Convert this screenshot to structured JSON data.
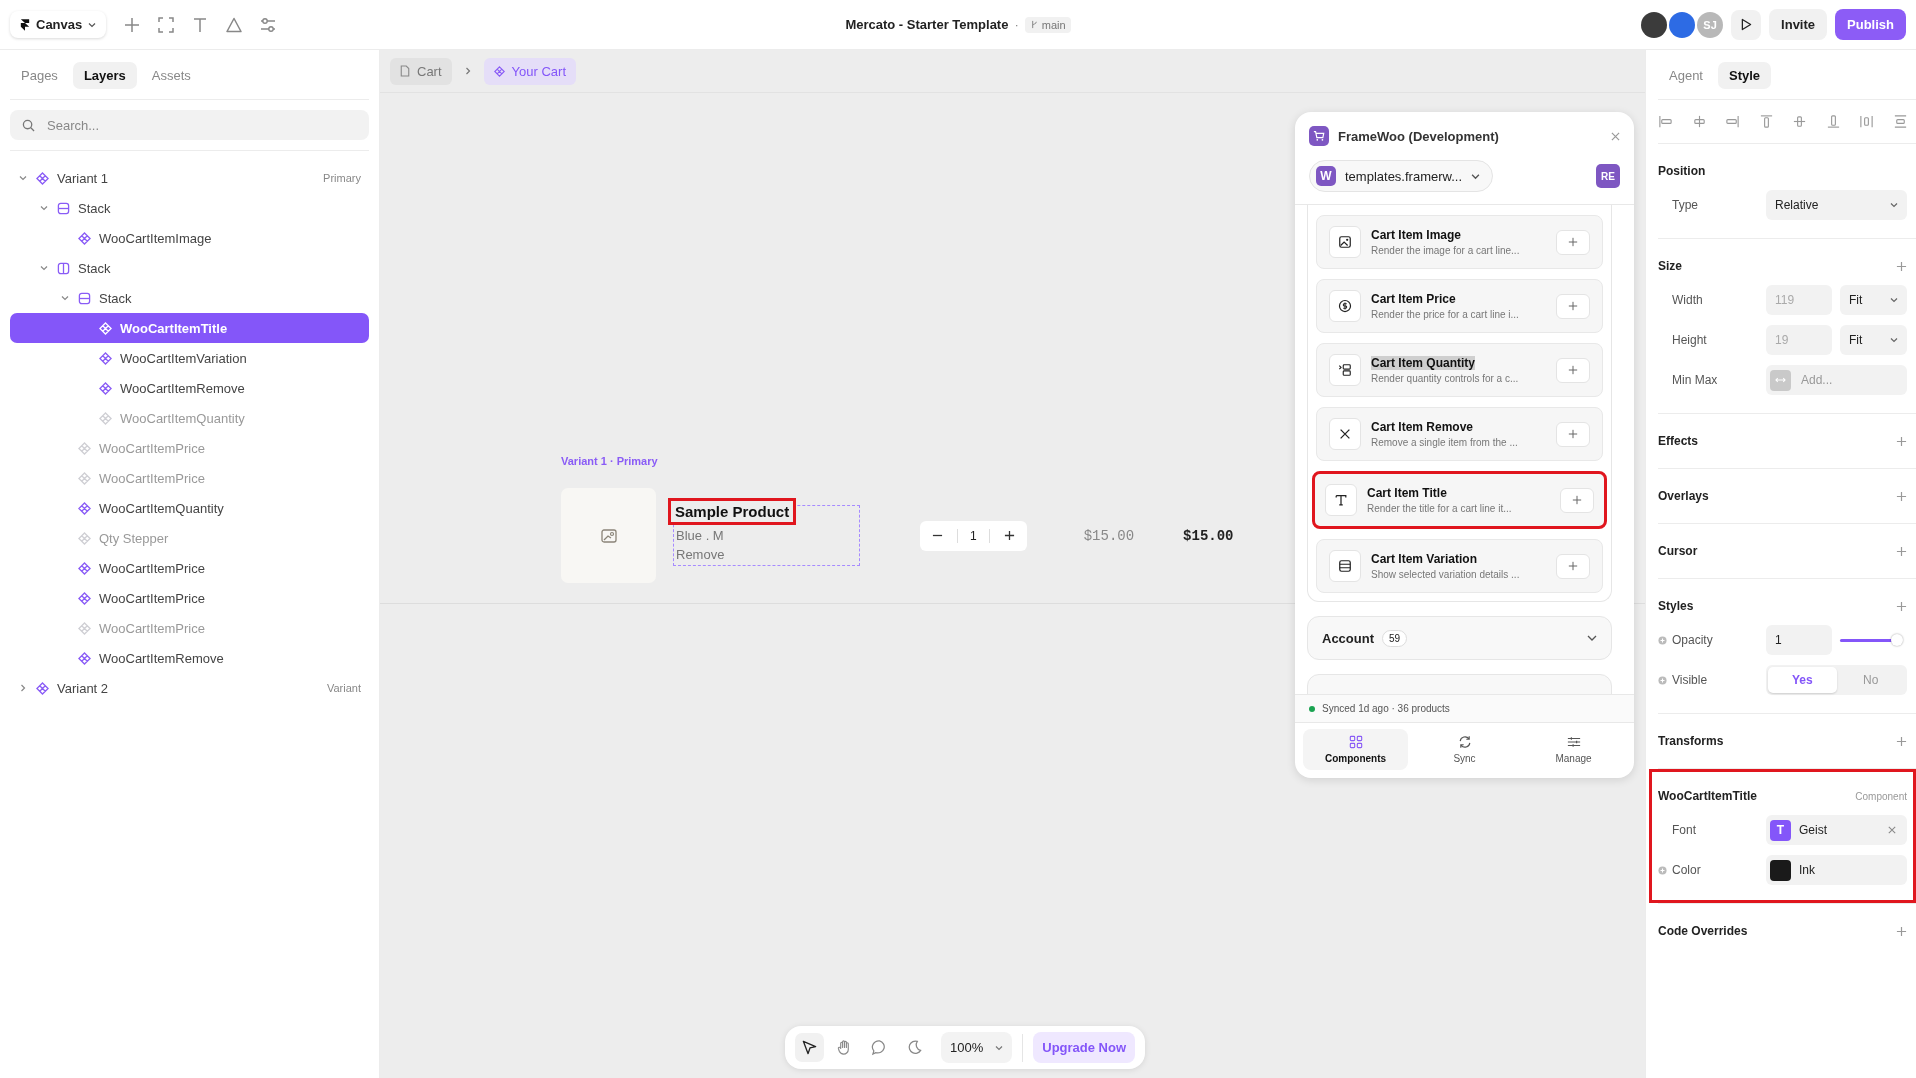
{
  "toolbar": {
    "menu_label": "Canvas",
    "title": "Mercato - Starter Template",
    "separator": "·",
    "branch": "main",
    "avatar_initials": "SJ",
    "invite": "Invite",
    "publish": "Publish"
  },
  "left_panel": {
    "tabs": [
      {
        "label": "Pages",
        "selected": false
      },
      {
        "label": "Layers",
        "selected": true
      },
      {
        "label": "Assets",
        "selected": false
      }
    ],
    "search": {
      "placeholder": "Search..."
    },
    "layers": [
      {
        "label": "Variant 1",
        "kind": "component",
        "badge": "Primary",
        "dimmed": false,
        "selected": false,
        "expanded": true,
        "children": [
          {
            "label": "Stack",
            "kind": "stack-rows",
            "dimmed": false,
            "selected": false,
            "expanded": true,
            "children": [
              {
                "label": "WooCartItemImage",
                "kind": "component",
                "dimmed": false,
                "selected": false
              }
            ]
          },
          {
            "label": "Stack",
            "kind": "stack-cols",
            "dimmed": false,
            "selected": false,
            "expanded": true,
            "children": [
              {
                "label": "Stack",
                "kind": "stack-rows",
                "dimmed": false,
                "selected": false,
                "expanded": true,
                "children": [
                  {
                    "label": "WooCartItemTitle",
                    "kind": "component",
                    "dimmed": false,
                    "selected": true
                  },
                  {
                    "label": "WooCartItemVariation",
                    "kind": "component",
                    "dimmed": false,
                    "selected": false
                  },
                  {
                    "label": "WooCartItemRemove",
                    "kind": "component",
                    "dimmed": false,
                    "selected": false
                  },
                  {
                    "label": "WooCartItemQuantity",
                    "kind": "component",
                    "dimmed": true,
                    "selected": false
                  }
                ]
              },
              {
                "label": "WooCartItemPrice",
                "kind": "component",
                "dimmed": true,
                "selected": false
              },
              {
                "label": "WooCartItemPrice",
                "kind": "component",
                "dimmed": true,
                "selected": false
              },
              {
                "label": "WooCartItemQuantity",
                "kind": "component",
                "dimmed": false,
                "selected": false
              },
              {
                "label": "Qty Stepper",
                "kind": "component",
                "dimmed": true,
                "selected": false
              },
              {
                "label": "WooCartItemPrice",
                "kind": "component",
                "dimmed": false,
                "selected": false
              },
              {
                "label": "WooCartItemPrice",
                "kind": "component",
                "dimmed": false,
                "selected": false
              },
              {
                "label": "WooCartItemPrice",
                "kind": "component",
                "dimmed": true,
                "selected": false
              },
              {
                "label": "WooCartItemRemove",
                "kind": "component",
                "dimmed": false,
                "selected": false
              }
            ]
          }
        ]
      },
      {
        "label": "Variant 2",
        "kind": "component",
        "badge": "Variant",
        "dimmed": false,
        "selected": false,
        "expanded": false
      }
    ]
  },
  "breadcrumb": [
    {
      "label": "Cart",
      "selected": false
    },
    {
      "label": "Your Cart",
      "selected": true
    }
  ],
  "canvas": {
    "variant_label": "Variant 1 · Primary",
    "item": {
      "title": "Sample Product",
      "title_highlighted": true,
      "variation": "Blue . M",
      "remove": "Remove",
      "quantity": "1",
      "price": "$15.00",
      "total": "$15.00"
    }
  },
  "plugin": {
    "title": "FrameWoo (Development)",
    "site": {
      "badge": "W",
      "label": "templates.framerw..."
    },
    "user_badge": "RE",
    "components": [
      {
        "title": "Cart Item Image",
        "description": "Render the image for a cart line...",
        "highlighted": false,
        "text_selected": false
      },
      {
        "title": "Cart Item Price",
        "description": "Render the price for a cart line i...",
        "highlighted": false,
        "text_selected": false
      },
      {
        "title": "Cart Item Quantity",
        "description": "Render quantity controls for a c...",
        "highlighted": false,
        "text_selected": true
      },
      {
        "title": "Cart Item Remove",
        "description": "Remove a single item from the ...",
        "highlighted": false,
        "text_selected": false
      },
      {
        "title": "Cart Item Title",
        "description": "Render the title for a cart line it...",
        "highlighted": true,
        "text_selected": false
      },
      {
        "title": "Cart Item Variation",
        "description": "Show selected variation details ...",
        "highlighted": false,
        "text_selected": false
      }
    ],
    "accordions": [
      {
        "label": "Account",
        "count": "59",
        "expanded": false
      }
    ],
    "status": "Synced 1d ago · 36 products",
    "tabs": [
      {
        "label": "Components",
        "selected": true
      },
      {
        "label": "Sync",
        "selected": false
      },
      {
        "label": "Manage",
        "selected": false
      }
    ]
  },
  "zoom_bar": {
    "tools": [
      {
        "kind": "pointer",
        "selected": true
      },
      {
        "kind": "hand",
        "selected": false
      },
      {
        "kind": "comment",
        "selected": false
      },
      {
        "kind": "moon",
        "selected": false
      }
    ],
    "zoom": "100%",
    "upgrade": "Upgrade Now"
  },
  "inspector": {
    "tabs": [
      {
        "label": "Agent",
        "selected": false
      },
      {
        "label": "Style",
        "selected": true
      }
    ],
    "sections": [
      {
        "title": "Position",
        "addable": false,
        "highlighted": false,
        "rows": [
          {
            "kind": "select",
            "label": "Type",
            "value": "Relative",
            "linkable": false
          }
        ]
      },
      {
        "title": "Size",
        "addable": true,
        "highlighted": false,
        "rows": [
          {
            "kind": "size",
            "label": "Width",
            "placeholder": "119",
            "unit": "Fit",
            "linkable": false
          },
          {
            "kind": "size",
            "label": "Height",
            "placeholder": "19",
            "unit": "Fit",
            "linkable": false
          },
          {
            "kind": "minmax",
            "label": "Min Max",
            "placeholder": "Add...",
            "linkable": false
          }
        ]
      },
      {
        "title": "Effects",
        "addable": true,
        "highlighted": false
      },
      {
        "title": "Overlays",
        "addable": true,
        "highlighted": false
      },
      {
        "title": "Cursor",
        "addable": true,
        "highlighted": false
      },
      {
        "title": "Styles",
        "addable": true,
        "highlighted": false,
        "rows": [
          {
            "kind": "slider",
            "label": "Opacity",
            "value": "1",
            "level": 1,
            "linkable": true
          },
          {
            "kind": "toggle",
            "label": "Visible",
            "linkable": true,
            "options": [
              {
                "label": "Yes",
                "selected": true
              },
              {
                "label": "No",
                "selected": false
              }
            ]
          }
        ]
      },
      {
        "title": "Transforms",
        "addable": true,
        "highlighted": false
      },
      {
        "title": "WooCartItemTitle",
        "badge": "Component",
        "addable": false,
        "highlighted": true,
        "rows": [
          {
            "kind": "font",
            "label": "Font",
            "value": "Geist",
            "badge": "T",
            "linkable": false
          },
          {
            "kind": "color",
            "label": "Color",
            "value": "Ink",
            "color": "#1a1a1a",
            "linkable": true
          }
        ]
      },
      {
        "title": "Code Overrides",
        "addable": true,
        "highlighted": false
      }
    ]
  }
}
